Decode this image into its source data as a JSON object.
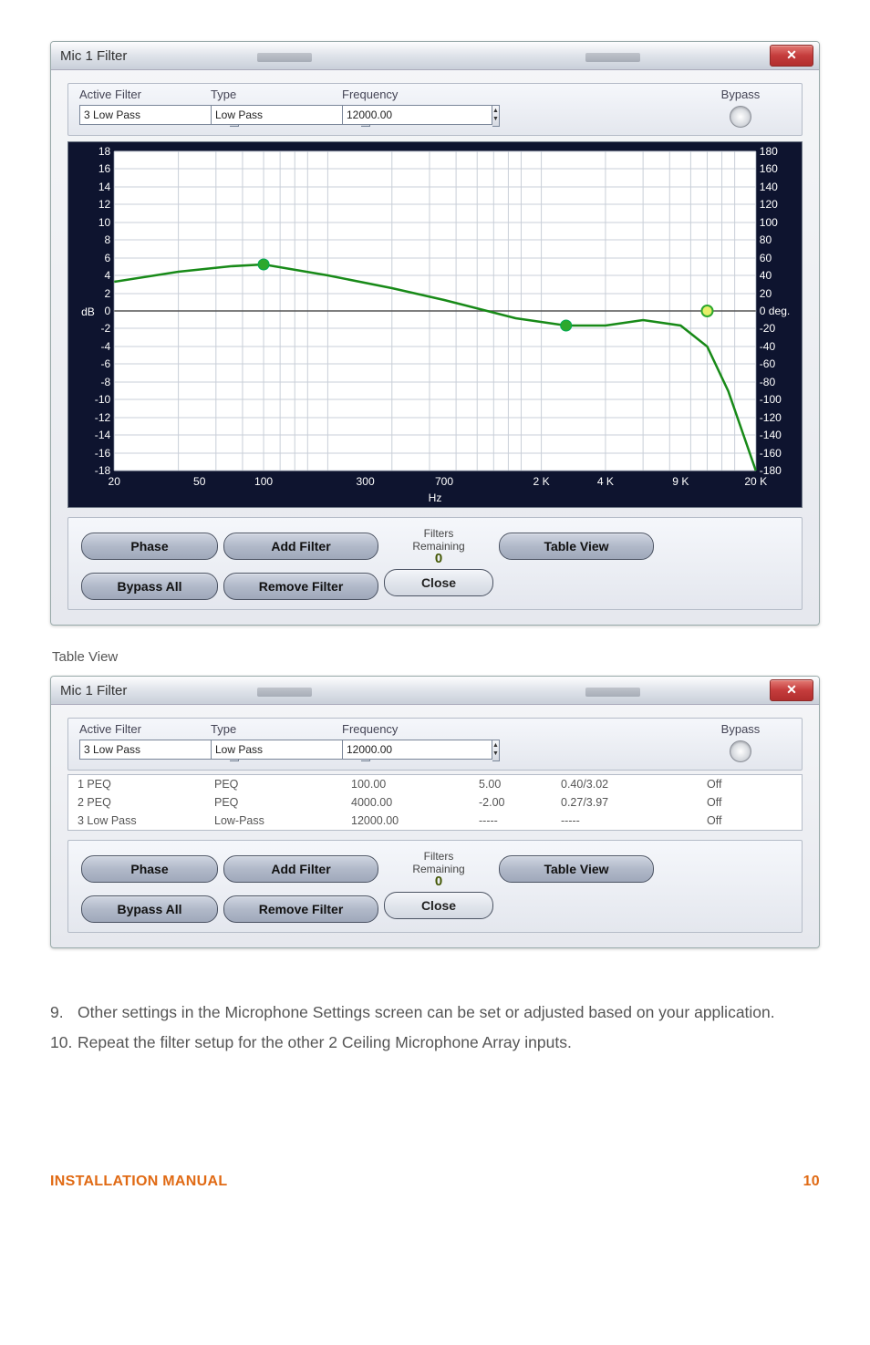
{
  "dialog1": {
    "title": "Mic 1 Filter",
    "active_filter_label": "Active Filter",
    "active_filter_value": "3 Low Pass",
    "type_label": "Type",
    "type_value": "Low Pass",
    "freq_label": "Frequency",
    "freq_value": "12000.00",
    "bypass_label": "Bypass",
    "buttons": {
      "phase": "Phase",
      "add_filter": "Add Filter",
      "bypass_all": "Bypass All",
      "remove_filter": "Remove Filter",
      "table_view": "Table View",
      "close": "Close"
    },
    "filters_remaining_label": "Filters\nRemaining",
    "filters_remaining_value": "0"
  },
  "chart_data": {
    "type": "line",
    "title": "",
    "xlabel": "Hz",
    "ylabel_left": "dB",
    "ylabel_right": "deg.",
    "y_left_ticks": [
      18,
      16,
      14,
      12,
      10,
      8,
      6,
      4,
      2,
      0,
      -2,
      -4,
      -6,
      -8,
      -10,
      -12,
      -14,
      -16,
      -18
    ],
    "y_right_ticks": [
      180,
      160,
      140,
      120,
      100,
      80,
      60,
      40,
      20,
      0,
      -20,
      -40,
      -60,
      -80,
      -100,
      -120,
      -140,
      -160,
      -180
    ],
    "x_ticks": [
      20,
      50,
      100,
      300,
      700,
      "2 K",
      "4 K",
      "9 K",
      "20 K"
    ],
    "xlim": [
      20,
      20000
    ],
    "ylim_left": [
      -18,
      18
    ],
    "ylim_right": [
      -180,
      180
    ],
    "series": [
      {
        "name": "response-db",
        "axis": "left",
        "data": [
          {
            "hz": 20,
            "val": 3.3
          },
          {
            "hz": 40,
            "val": 4.4
          },
          {
            "hz": 70,
            "val": 5.0
          },
          {
            "hz": 100,
            "val": 5.2
          },
          {
            "hz": 200,
            "val": 4.0
          },
          {
            "hz": 400,
            "val": 2.6
          },
          {
            "hz": 700,
            "val": 1.2
          },
          {
            "hz": 1500,
            "val": -0.8
          },
          {
            "hz": 2500,
            "val": -1.7
          },
          {
            "hz": 4000,
            "val": -1.6
          },
          {
            "hz": 6000,
            "val": -1.0
          },
          {
            "hz": 9000,
            "val": -1.6
          },
          {
            "hz": 12000,
            "val": -4.0
          },
          {
            "hz": 15000,
            "val": -9.0
          },
          {
            "hz": 20000,
            "val": -18.0
          }
        ]
      }
    ],
    "markers": [
      {
        "hz": 100,
        "db": 5.2,
        "color": "#2da82d"
      },
      {
        "hz": 2500,
        "db": -1.7,
        "color": "#2da82d"
      },
      {
        "hz": 12000,
        "db": 0,
        "color": "#d6e24a",
        "ring": "#2da82d"
      }
    ]
  },
  "section_label": "Table View",
  "dialog2": {
    "title": "Mic 1 Filter",
    "active_filter_label": "Active Filter",
    "active_filter_value": "3 Low Pass",
    "type_label": "Type",
    "type_value": "Low Pass",
    "freq_label": "Frequency",
    "freq_value": "12000.00",
    "bypass_label": "Bypass",
    "rows": [
      {
        "c1": "1 PEQ",
        "c2": "PEQ",
        "c3": "100.00",
        "c4": "5.00",
        "c5": "0.40/3.02",
        "c6": "Off"
      },
      {
        "c1": "2 PEQ",
        "c2": "PEQ",
        "c3": "4000.00",
        "c4": "-2.00",
        "c5": "0.27/3.97",
        "c6": "Off"
      },
      {
        "c1": "3 Low Pass",
        "c2": "Low-Pass",
        "c3": "12000.00",
        "c4": "-----",
        "c5": "-----",
        "c6": "Off"
      }
    ],
    "buttons": {
      "phase": "Phase",
      "add_filter": "Add Filter",
      "bypass_all": "Bypass All",
      "remove_filter": "Remove Filter",
      "table_view": "Table View",
      "close": "Close"
    },
    "filters_remaining_label": "Filters\nRemaining",
    "filters_remaining_value": "0"
  },
  "body_text": {
    "item9_num": "9.",
    "item9": "Other settings in the Microphone Settings screen can be set or adjusted based on your application.",
    "item10_num": "10.",
    "item10": "Repeat the filter setup for the other 2 Ceiling Microphone Array inputs."
  },
  "footer": {
    "left": "INSTALLATION MANUAL",
    "right": "10"
  }
}
